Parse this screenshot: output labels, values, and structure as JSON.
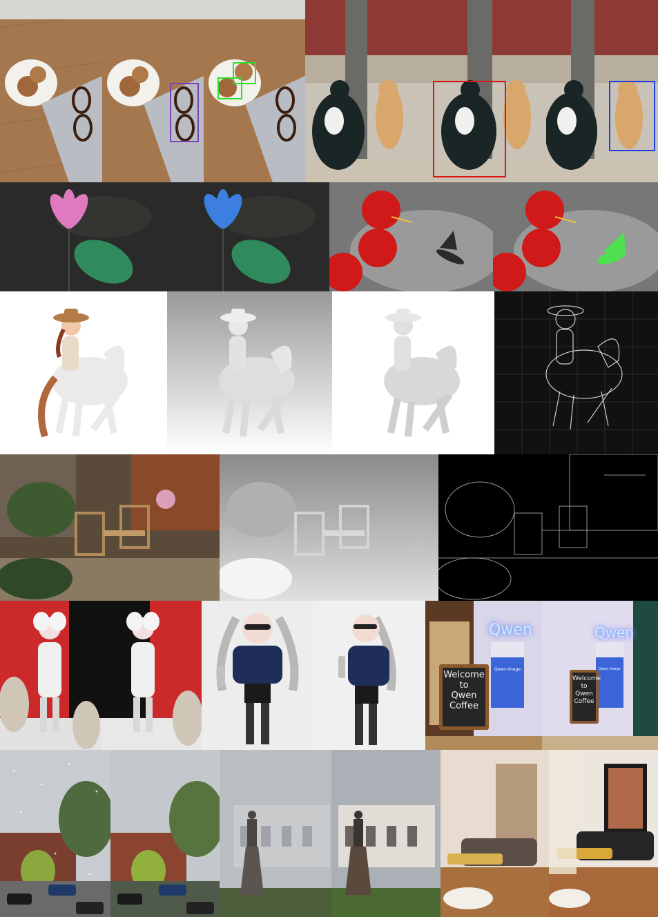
{
  "colors": {
    "bbox_purple": "#7b3fb8",
    "bbox_green": "#28e02a",
    "bbox_red": "#e01414",
    "bbox_blue": "#1f3fe0",
    "neon": "#a8d8ff"
  },
  "cafe": {
    "neon_sign": "Qwen",
    "chalkboard_lines": [
      "Welcome",
      "to",
      "Qwen",
      "Coffee"
    ],
    "poster_label": "Qwen-Image"
  },
  "icons": [
    "cookie-plate",
    "glasses",
    "laptop",
    "cat",
    "tree",
    "lotus",
    "hibiscus",
    "hummingbird",
    "cowgirl-horse",
    "chair",
    "girl-figure",
    "cafe-storefront",
    "house",
    "statue",
    "sofa"
  ]
}
